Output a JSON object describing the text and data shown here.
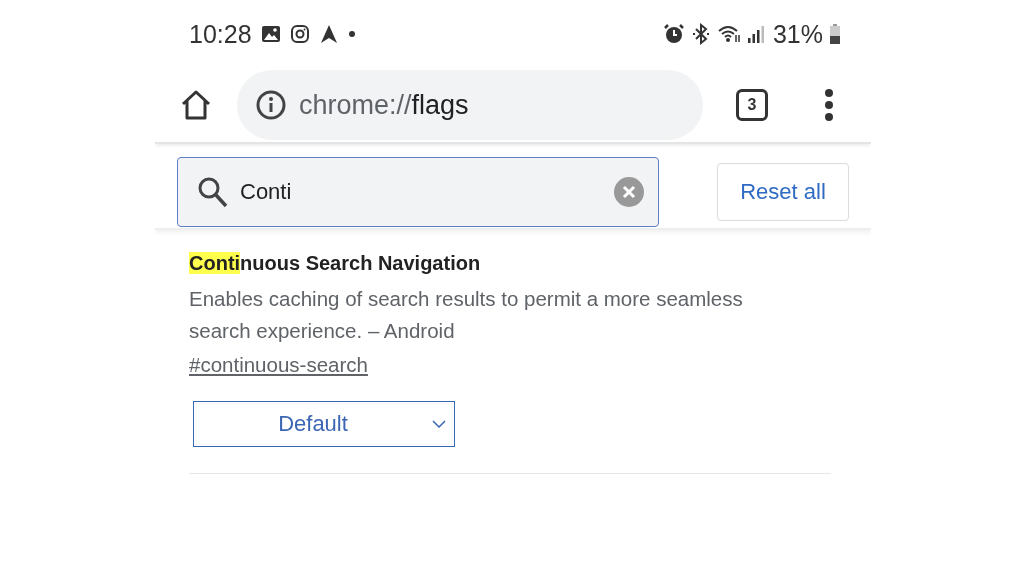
{
  "status_bar": {
    "time": "10:28",
    "battery": "31%"
  },
  "toolbar": {
    "url_scheme": "chrome://",
    "url_host": "flags",
    "tab_count": "3"
  },
  "search": {
    "value": "Conti"
  },
  "reset_button": "Reset all",
  "flags": [
    {
      "title_match": "Conti",
      "title_rest": "nuous Search Navigation",
      "description": "Enables caching of search results to permit a more seamless search experience. – Android",
      "link": "#continuous-search",
      "select": "Default"
    }
  ]
}
